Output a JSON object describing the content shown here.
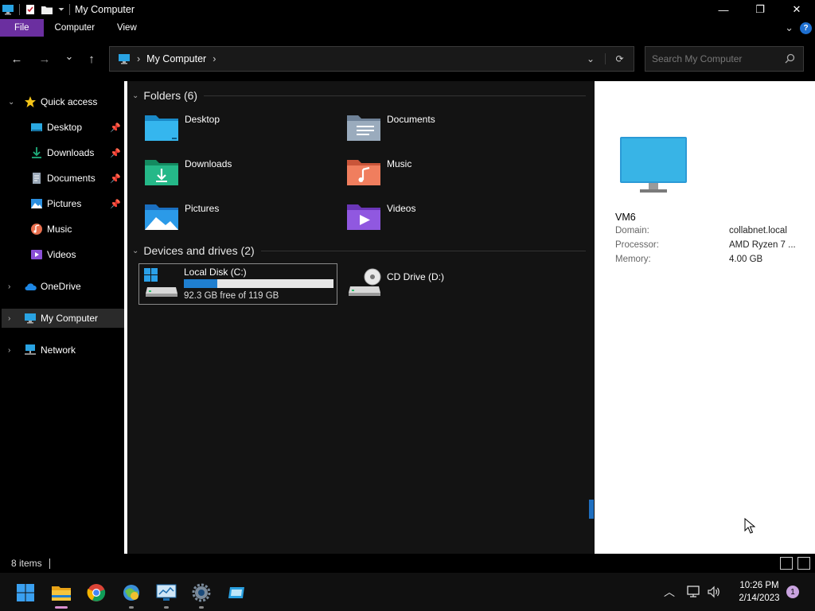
{
  "window": {
    "title": "My Computer",
    "controls": {
      "minimize": "—",
      "maximize": "❐",
      "close": "✕"
    }
  },
  "ribbon": {
    "tabs": [
      {
        "label": "File"
      },
      {
        "label": "Computer"
      },
      {
        "label": "View"
      }
    ],
    "help": "?"
  },
  "navbar": {
    "back": "←",
    "forward": "→",
    "recent": "⌄",
    "up": "↑",
    "breadcrumb": [
      "My Computer"
    ],
    "refresh": "⟳",
    "search_placeholder": "Search My Computer"
  },
  "sidebar": {
    "items": [
      {
        "label": "Quick access",
        "pinned": false
      },
      {
        "label": "Desktop",
        "pinned": true
      },
      {
        "label": "Downloads",
        "pinned": true
      },
      {
        "label": "Documents",
        "pinned": true
      },
      {
        "label": "Pictures",
        "pinned": true
      },
      {
        "label": "Music",
        "pinned": false
      },
      {
        "label": "Videos",
        "pinned": false
      },
      {
        "label": "OneDrive",
        "pinned": false
      },
      {
        "label": "My Computer",
        "pinned": false
      },
      {
        "label": "Network",
        "pinned": false
      }
    ]
  },
  "main": {
    "folders_header": "Folders (6)",
    "folders": [
      {
        "label": "Desktop",
        "color": "#2aa8e0"
      },
      {
        "label": "Documents",
        "color": "#8aa0b8"
      },
      {
        "label": "Downloads",
        "color": "#1fae7c"
      },
      {
        "label": "Music",
        "color": "#e86f4e"
      },
      {
        "label": "Pictures",
        "color": "#2b8fe0"
      },
      {
        "label": "Videos",
        "color": "#8a4fd6"
      }
    ],
    "drives_header": "Devices and drives (2)",
    "drives": [
      {
        "label": "Local Disk (C:)",
        "free": "92.3 GB free of 119 GB",
        "used_fraction": 0.224
      },
      {
        "label": "CD Drive (D:)"
      }
    ]
  },
  "details": {
    "name": "VM6",
    "props": [
      {
        "key": "Domain:",
        "value": "collabnet.local"
      },
      {
        "key": "Processor:",
        "value": "AMD Ryzen 7 ..."
      },
      {
        "key": "Memory:",
        "value": "4.00 GB"
      }
    ]
  },
  "status": {
    "count": "8 items"
  },
  "taskbar": {
    "time": "10:26 PM",
    "date": "2/14/2023",
    "notifications": "1"
  }
}
